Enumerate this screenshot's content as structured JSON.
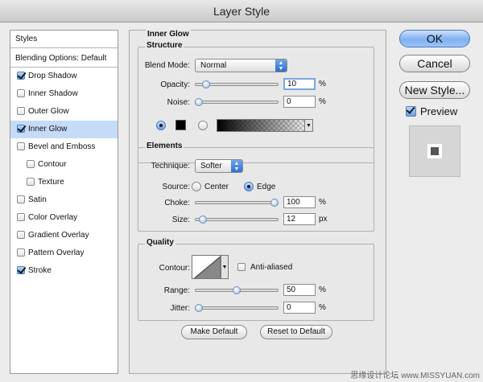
{
  "window": {
    "title": "Layer Style"
  },
  "styles_list": {
    "header": "Styles",
    "blending_options": "Blending Options: Default",
    "items": [
      {
        "label": "Drop Shadow",
        "checked": true
      },
      {
        "label": "Inner Shadow",
        "checked": false
      },
      {
        "label": "Outer Glow",
        "checked": false
      },
      {
        "label": "Inner Glow",
        "checked": true,
        "selected": true
      },
      {
        "label": "Bevel and Emboss",
        "checked": false
      },
      {
        "label": "Contour",
        "checked": false,
        "indent": true
      },
      {
        "label": "Texture",
        "checked": false,
        "indent": true
      },
      {
        "label": "Satin",
        "checked": false
      },
      {
        "label": "Color Overlay",
        "checked": false
      },
      {
        "label": "Gradient Overlay",
        "checked": false
      },
      {
        "label": "Pattern Overlay",
        "checked": false
      },
      {
        "label": "Stroke",
        "checked": true
      }
    ]
  },
  "panel": {
    "title": "Inner Glow",
    "structure": {
      "title": "Structure",
      "blend_mode_label": "Blend Mode:",
      "blend_mode_value": "Normal",
      "opacity_label": "Opacity:",
      "opacity_value": "10",
      "opacity_unit": "%",
      "opacity_fraction": 0.1,
      "noise_label": "Noise:",
      "noise_value": "0",
      "noise_unit": "%",
      "noise_fraction": 0.0
    },
    "elements": {
      "title": "Elements",
      "technique_label": "Technique:",
      "technique_value": "Softer",
      "source_label": "Source:",
      "source_center": "Center",
      "source_edge": "Edge",
      "choke_label": "Choke:",
      "choke_value": "100",
      "choke_unit": "%",
      "choke_fraction": 1.0,
      "size_label": "Size:",
      "size_value": "12",
      "size_unit": "px",
      "size_fraction": 0.05
    },
    "quality": {
      "title": "Quality",
      "contour_label": "Contour:",
      "anti_aliased_label": "Anti-aliased",
      "range_label": "Range:",
      "range_value": "50",
      "range_unit": "%",
      "range_fraction": 0.5,
      "jitter_label": "Jitter:",
      "jitter_value": "0",
      "jitter_unit": "%",
      "jitter_fraction": 0.0
    },
    "make_default": "Make Default",
    "reset_to_default": "Reset to Default"
  },
  "buttons": {
    "ok": "OK",
    "cancel": "Cancel",
    "new_style": "New Style...",
    "preview": "Preview"
  },
  "watermark": "思缘设计论坛  www.MISSYUAN.com",
  "colors": {
    "selection": "#c5dbf8",
    "accent": "#4d7fc1",
    "glow_color": "#000000"
  }
}
